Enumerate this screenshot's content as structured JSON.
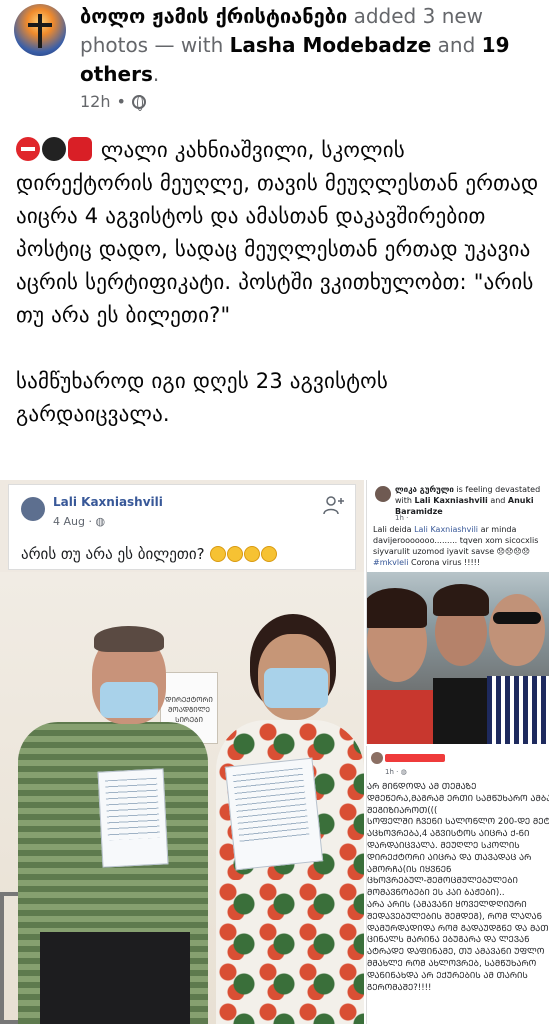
{
  "post": {
    "page_name": "ბოლო ჟამის ქრისტიანები",
    "action": " added 3 new photos — with ",
    "tagged_user": "Lasha Modebadze",
    "and": " and ",
    "others": "19 others",
    "period": ".",
    "time": "12h",
    "dot": "•",
    "paragraph1": "ლალი კახნიაშვილი, სკოლის დირექტორის მეუღლე, თავის მეუღლესთან ერთად აიცრა 4 აგვისტოს და ამასთან დაკავშირებით პოსტიც დადო, სადაც მეუღლესთან ერთად უკავია აცრის სერტიფიკატი.  პოსტში ვკითხულობთ: \"არის თუ არა ეს ბილეთი?\"",
    "paragraph2": "სამწუხაროდ იგი დღეს 23 აგვისტოს გარდაიცვალა."
  },
  "photo_left": {
    "name": "Lali Kaxniashvili",
    "date": "4 Aug ·",
    "text": "არის თუ არა ეს ბილეთი?",
    "door_sign": "ᲓᲘᲠᲔᲥᲢᲝᲠᲘ ᲛᲝᲐᲓᲒᲘᲚᲔ ᲡᲘᲠᲔᲑᲘ"
  },
  "photo_rt": {
    "name": "ლიკა გურული",
    "is": " is ",
    "feeling": "feeling devastated with ",
    "with1": "Lali Kaxniashvili",
    "and": " and ",
    "with2": "Anuki Baramidze",
    "time": "1h · ",
    "text1": "Lali deida ",
    "text_link": "Lali Kaxniashvili",
    "text2": " ar minda davijerooooooo......... tqven xom sicocxlis siyvarulit uzomod iyavit  savse",
    "hashtag": "#mkvleli",
    "text3": " Corona virus !!!!!"
  },
  "photo_rb": {
    "time": "1h · ",
    "text": "ᲐᲠ ᲛᲘᲜᲓᲝᲓᲐ ᲐᲛ ᲗᲔᲛᲐᲖᲔ\nᲓᲛᲔᲬᲔᲠᲐ,ᲛᲐᲒᲠᲐᲛ ᲔᲠᲗᲘ ᲡᲐᲛᲬᲣᲮᲐᲠᲝ ᲐᲛᲑᲐᲕ\nᲨᲔᲒᲘᲖᲘᲐᲠᲝᲗ(((\nᲡᲝᲤᲔᲚᲨᲘ ᲩᲕᲔᲜᲘ ᲡᲐᲚᲝᲜᲚᲝ 200-ᲓᲔ ᲛᲔᲢᲠᲨ\nᲐᲪᲮᲝᲕᲠᲔᲑᲐ,4 ᲐᲒᲕᲘᲡᲢᲝᲡ ᲐᲘᲪᲠᲐ Ქ-ᲜᲘ\nᲓᲐᲠᲓᲐᲘᲪᲕᲐᲚᲐ. ᲛᲔᲣᲦᲚᲔ ᲡᲙᲝᲚᲘᲡ\nᲓᲘᲠᲔᲥᲢᲝᲠᲘ ᲐᲘᲪᲠᲐ ᲓᲐ ᲗᲐᲕᲐᲓᲐᲪ ᲐᲠ\nᲐᲛᲝᲠᲩᲐ(ᲘᲡ ᲘᲧᲕᲜᲔᲜ\nᲪᲮᲝᲕᲠᲔᲑᲣᲚ-ᲨᲔᲛᲝᲪᲛᲣᲚᲔᲑᲣᲚᲔᲑᲘ\nᲛᲝᲛᲐᲕᲜᲝᲑᲔᲑᲘ ᲔᲡ ᲙᲐᲘ ᲑᲐᲟᲔᲑᲘ)..\nᲐᲠᲐ ᲐᲠᲘᲡ (ᲐᲛᲐᲕᲐᲜᲘ ᲧᲝᲕᲔᲚᲓᲦᲘᲣᲠᲘ\nᲨᲔᲓᲐᲕᲔᲑᲣᲚᲔᲑᲘᲡ ᲨᲔᲛᲓᲔᲒ), ᲠᲝᲛ ᲚᲐᲦᲐᲜ\nᲓᲐᲛᲣᲠᲓᲐᲓᲘᲓᲐ ᲠᲝᲛ ᲒᲐᲓᲐᲣᲓᲒᲜᲔ ᲓᲐ ᲛᲐᲗ\nᲪᲘᲜᲐᲚᲡ ᲛᲐᲠᲘᲜᲐ ᲔᲑᲣᲒᲐᲠᲐ ᲓᲐ ᲚᲔᲕᲐᲜ\nᲐᲢᲠᲐᲓᲔ ᲓᲐᲤᲘᲜᲐᲛᲔ, ᲗᲣ ᲐᲛᲐᲕᲐᲜᲘ ᲣᲤᲚᲝ\nᲛᲛᲐᲮᲚᲔ ᲠᲝᲛ ᲐᲮᲚᲝᲕᲠᲔᲑ, ᲡᲐᲛᲬᲣᲮᲐᲠᲝ\nᲓᲐᲜᲘᲜᲐᲮᲓᲐ ᲐᲠ ᲔᲥᲣᲠᲔᲑᲘᲡ ᲐᲛ ᲗᲐᲠᲘᲡ\nᲒᲔᲠᲝᲛᲐᲨᲔ?!!!!"
  },
  "colors": {
    "link": "#385898",
    "meta": "#65676b",
    "text": "#050505"
  }
}
